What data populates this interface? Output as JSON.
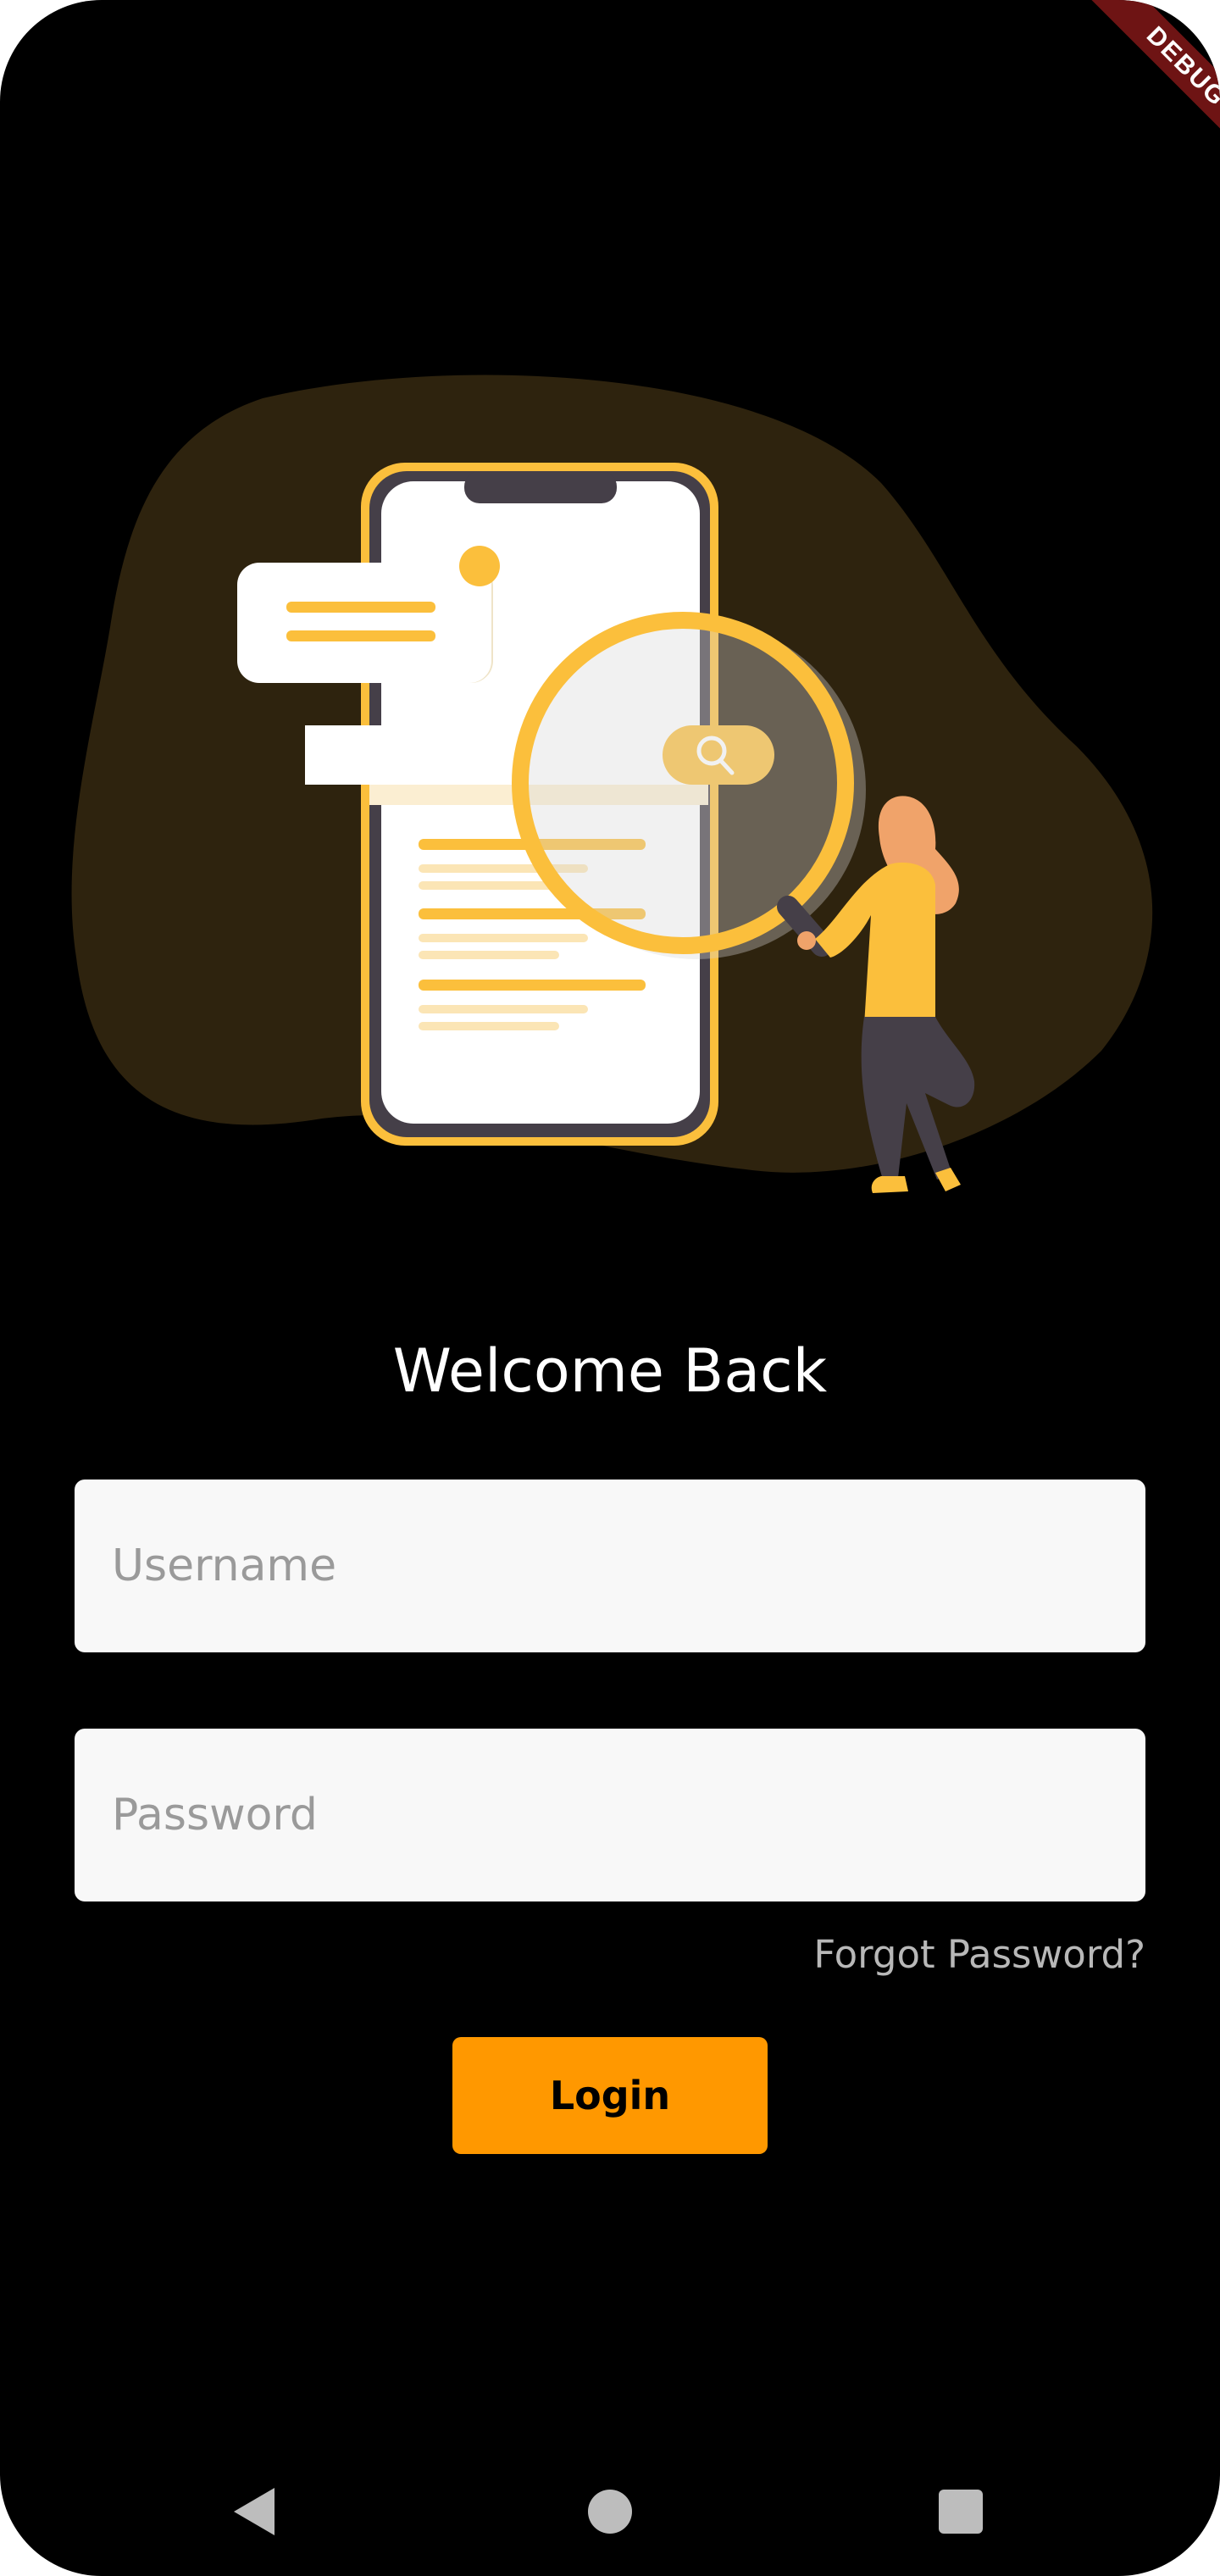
{
  "debug_banner": {
    "label": "DEBUG"
  },
  "illustration": {
    "name": "search-illustration"
  },
  "welcome": {
    "title": "Welcome Back"
  },
  "form": {
    "username": {
      "placeholder": "Username",
      "value": ""
    },
    "password": {
      "placeholder": "Password",
      "value": ""
    },
    "forgot_label": "Forgot Password?",
    "login_label": "Login"
  },
  "colors": {
    "background": "#000000",
    "accent": "#ff9800",
    "illustration_yellow": "#fbbf3c",
    "blob": "#2e230e",
    "field_bg": "#f8f8f8"
  },
  "nav": {
    "back_icon": "back-triangle-icon",
    "home_icon": "home-circle-icon",
    "recents_icon": "recents-square-icon"
  }
}
